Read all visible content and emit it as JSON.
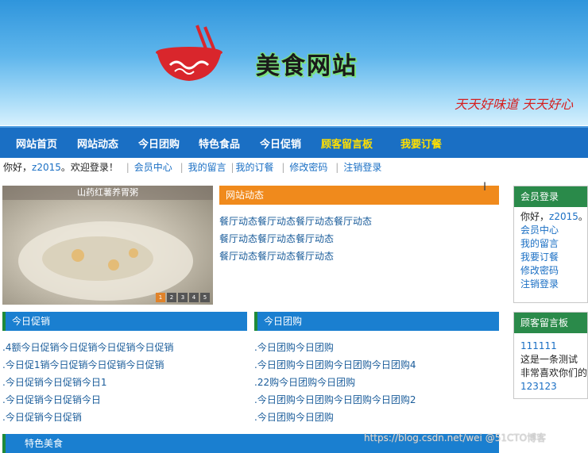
{
  "header": {
    "title": "美食网站",
    "slogan": "天天好味道 天天好心",
    "colors": {
      "banner_top": "#2f95dc",
      "bowl_red": "#d9262c"
    }
  },
  "nav": {
    "items": [
      {
        "label": "网站首页",
        "highlight": false
      },
      {
        "label": "网站动态",
        "highlight": false
      },
      {
        "label": "今日团购",
        "highlight": false
      },
      {
        "label": "特色食品",
        "highlight": false
      },
      {
        "label": "今日促销",
        "highlight": false
      },
      {
        "label": "顾客留言板",
        "highlight": true
      },
      {
        "label": "我要订餐",
        "highlight": true
      }
    ]
  },
  "userbar": {
    "greeting_prefix": "你好，",
    "username": "z2015",
    "greeting_suffix": "。欢迎登录！",
    "links": [
      "会员中心",
      "我的留言",
      "我的订餐",
      "修改密码",
      "注销登录"
    ]
  },
  "slider": {
    "caption": "山药红薯养胃粥",
    "dots": [
      "1",
      "2",
      "3",
      "4",
      "5"
    ],
    "active": 1
  },
  "news": {
    "title": "网站动态",
    "items": [
      "餐厅动态餐厅动态餐厅动态餐厅动态",
      "餐厅动态餐厅动态餐厅动态",
      "餐厅动态餐厅动态餐厅动态"
    ]
  },
  "promo": {
    "title": "今日促销",
    "items": [
      ".4额今日促销今日促销今日促销今日促销",
      ".今日促1销今日促销今日促销今日促销",
      ".今日促销今日促销今日1",
      ".今日促销今日促销今日",
      ".今日促销今日促销"
    ]
  },
  "group": {
    "title": "今日团购",
    "items": [
      ".今日团购今日团购",
      ".今日团购今日团购今日团购今日团购4",
      ".22购今日团购今日团购",
      ".今日团购今日团购今日团购今日团购2",
      ".今日团购今日团购"
    ]
  },
  "member": {
    "title": "会员登录",
    "greeting": "你好，",
    "username": "z2015",
    "greeting_end": "。",
    "links": [
      "会员中心",
      "我的留言",
      "我要订餐",
      "修改密码",
      "注销登录"
    ]
  },
  "guestbook": {
    "title": "顾客留言板",
    "items": [
      "111111",
      "这是一条测试",
      "非常喜欢你们的",
      "123123"
    ]
  },
  "featured": {
    "title": "特色美食"
  },
  "watermark": "https://blog.csdn.net/wei  @51CTO博客"
}
